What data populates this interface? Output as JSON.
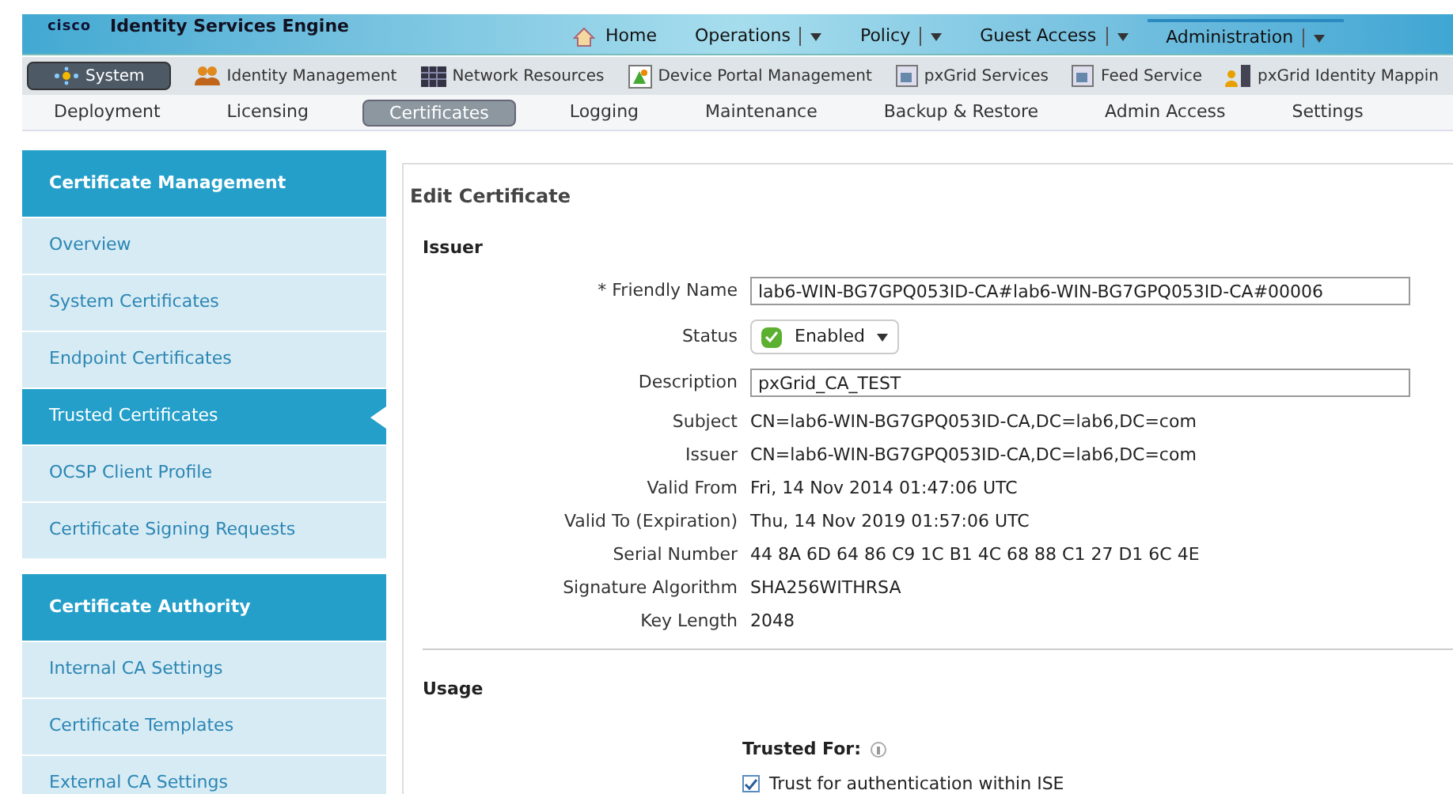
{
  "header": {
    "logo": "cisco",
    "title": "Identity Services Engine"
  },
  "top_nav": [
    {
      "label": "Home",
      "kind": "home",
      "selected": false
    },
    {
      "label": "Operations",
      "kind": "menu",
      "selected": false
    },
    {
      "label": "Policy",
      "kind": "menu",
      "selected": false
    },
    {
      "label": "Guest Access",
      "kind": "menu",
      "selected": false
    },
    {
      "label": "Administration",
      "kind": "menu",
      "selected": true
    }
  ],
  "modules": [
    {
      "label": "System",
      "selected": true
    },
    {
      "label": "Identity Management",
      "selected": false
    },
    {
      "label": "Network Resources",
      "selected": false
    },
    {
      "label": "Device Portal Management",
      "selected": false
    },
    {
      "label": "pxGrid Services",
      "selected": false
    },
    {
      "label": "Feed Service",
      "selected": false
    },
    {
      "label": "pxGrid Identity Mappin",
      "selected": false
    }
  ],
  "subtabs": [
    {
      "label": "Deployment",
      "selected": false
    },
    {
      "label": "Licensing",
      "selected": false
    },
    {
      "label": "Certificates",
      "selected": true
    },
    {
      "label": "Logging",
      "selected": false
    },
    {
      "label": "Maintenance",
      "selected": false
    },
    {
      "label": "Backup & Restore",
      "selected": false
    },
    {
      "label": "Admin Access",
      "selected": false
    },
    {
      "label": "Settings",
      "selected": false
    }
  ],
  "sidebar": [
    {
      "title": "Certificate Management",
      "items": [
        {
          "label": "Overview",
          "selected": false
        },
        {
          "label": "System Certificates",
          "selected": false
        },
        {
          "label": "Endpoint Certificates",
          "selected": false
        },
        {
          "label": "Trusted Certificates",
          "selected": true
        },
        {
          "label": "OCSP Client Profile",
          "selected": false
        },
        {
          "label": "Certificate Signing Requests",
          "selected": false
        }
      ]
    },
    {
      "title": "Certificate Authority",
      "items": [
        {
          "label": "Internal CA Settings",
          "selected": false
        },
        {
          "label": "Certificate Templates",
          "selected": false
        },
        {
          "label": "External CA Settings",
          "selected": false
        }
      ]
    }
  ],
  "content": {
    "title": "Edit Certificate",
    "issuer": {
      "heading": "Issuer",
      "fields": [
        {
          "kind": "input",
          "label": "* Friendly Name",
          "value": "lab6-WIN-BG7GPQ053ID-CA#lab6-WIN-BG7GPQ053ID-CA#00006"
        },
        {
          "kind": "status",
          "label": "Status",
          "value": "Enabled",
          "checked": true
        },
        {
          "kind": "input",
          "label": "Description",
          "value": "pxGrid_CA_TEST"
        },
        {
          "kind": "text",
          "label": "Subject",
          "value": "CN=lab6-WIN-BG7GPQ053ID-CA,DC=lab6,DC=com"
        },
        {
          "kind": "text",
          "label": "Issuer",
          "value": "CN=lab6-WIN-BG7GPQ053ID-CA,DC=lab6,DC=com"
        },
        {
          "kind": "text",
          "label": "Valid From",
          "value": "Fri, 14 Nov 2014 01:47:06 UTC"
        },
        {
          "kind": "text",
          "label": "Valid To (Expiration)",
          "value": "Thu, 14 Nov 2019 01:57:06 UTC"
        },
        {
          "kind": "text",
          "label": "Serial Number",
          "value": "44 8A 6D 64 86 C9 1C B1 4C 68 88 C1 27 D1 6C 4E"
        },
        {
          "kind": "text",
          "label": "Signature Algorithm",
          "value": "SHA256WITHRSA"
        },
        {
          "kind": "text",
          "label": "Key Length",
          "value": "2048"
        }
      ]
    },
    "usage": {
      "heading": "Usage",
      "trusted_for": "Trusted For:",
      "options": [
        {
          "label": "Trust for authentication within ISE",
          "checked": true
        }
      ]
    }
  }
}
